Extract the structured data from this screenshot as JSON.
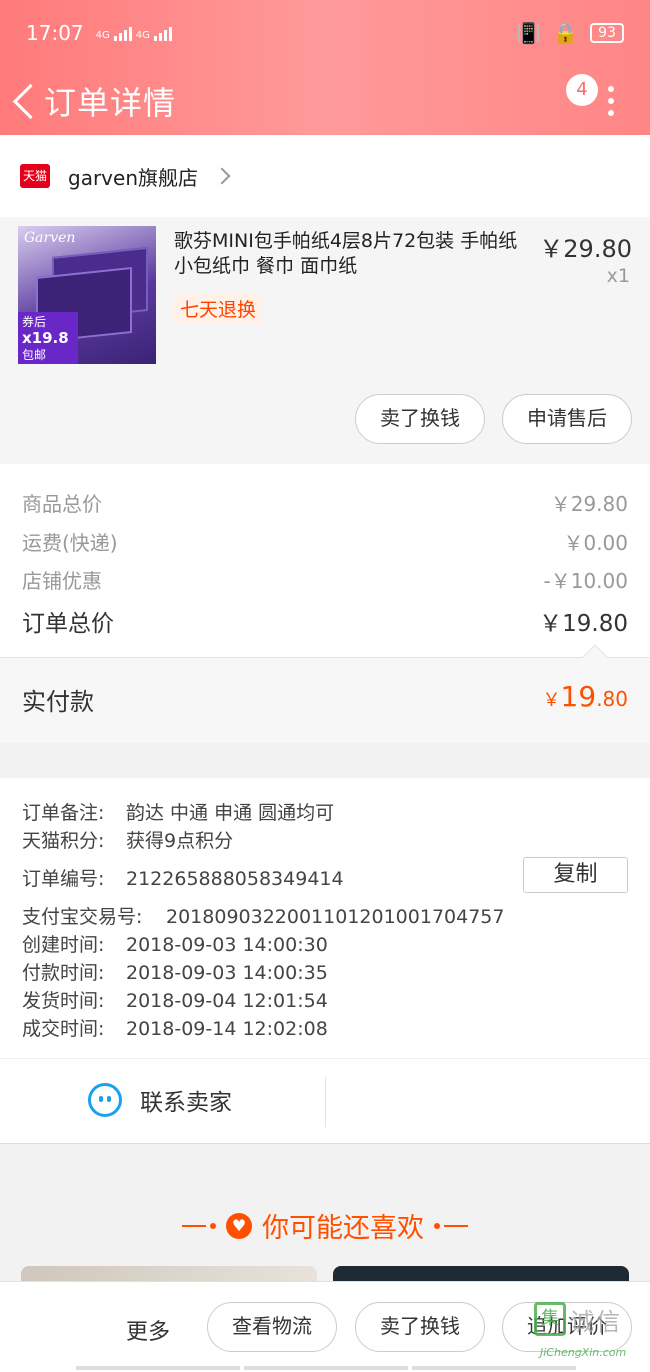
{
  "status": {
    "time": "17:07",
    "net1": "4G",
    "net2": "4G",
    "battery": "93"
  },
  "nav": {
    "title": "订单详情",
    "badge": "4"
  },
  "shop": {
    "tag": "天猫",
    "name": "garven旗舰店"
  },
  "product": {
    "title": "歌芬MINI包手帕纸4层8片72包装 手帕纸 小包纸巾 餐巾 面巾纸",
    "price": "￥29.80",
    "qty": "x1",
    "tag": "七天退换",
    "image": {
      "brand": "Garven",
      "promo_line1": "券后",
      "promo_price": "x19.8",
      "promo_line2": "包邮"
    },
    "buttons": [
      "卖了换钱",
      "申请售后"
    ]
  },
  "summary": {
    "rows": [
      {
        "label": "商品总价",
        "value": "￥29.80"
      },
      {
        "label": "运费(快递)",
        "value": "￥0.00"
      },
      {
        "label": "店铺优惠",
        "value": "-￥10.00"
      }
    ],
    "total": {
      "label": "订单总价",
      "value": "￥19.80"
    },
    "paid": {
      "label": "实付款",
      "currency": "￥",
      "int": "19",
      "dec": ".80"
    }
  },
  "info": {
    "rows": [
      {
        "label": "订单备注:",
        "value": "韵达 中通 申通 圆通均可"
      },
      {
        "label": "天猫积分:",
        "value": "获得9点积分"
      },
      {
        "label": "订单编号:",
        "value": "2122658880583494​14"
      },
      {
        "label": "支付宝交易号:",
        "value": "2018090322001101201001704757"
      },
      {
        "label": "创建时间:",
        "value": "2018-09-03 14:00:30"
      },
      {
        "label": "付款时间:",
        "value": "2018-09-03 14:00:35"
      },
      {
        "label": "发货时间:",
        "value": "2018-09-04 12:01:54"
      },
      {
        "label": "成交时间:",
        "value": "2018-09-14 12:02:08"
      }
    ],
    "copy_label": "复制"
  },
  "contact": {
    "label": "联系卖家"
  },
  "recommend": {
    "title": "你可能还喜欢"
  },
  "bottom": {
    "more": "更多",
    "buttons": [
      "查看物流",
      "卖了换钱",
      "追加评价"
    ]
  },
  "watermark": {
    "char": "集",
    "text": "诚信",
    "sub": "JiChengXin.com"
  },
  "colors": {
    "header": "#ff8585",
    "accent": "#ff5000",
    "tmall": "#e4001b"
  }
}
